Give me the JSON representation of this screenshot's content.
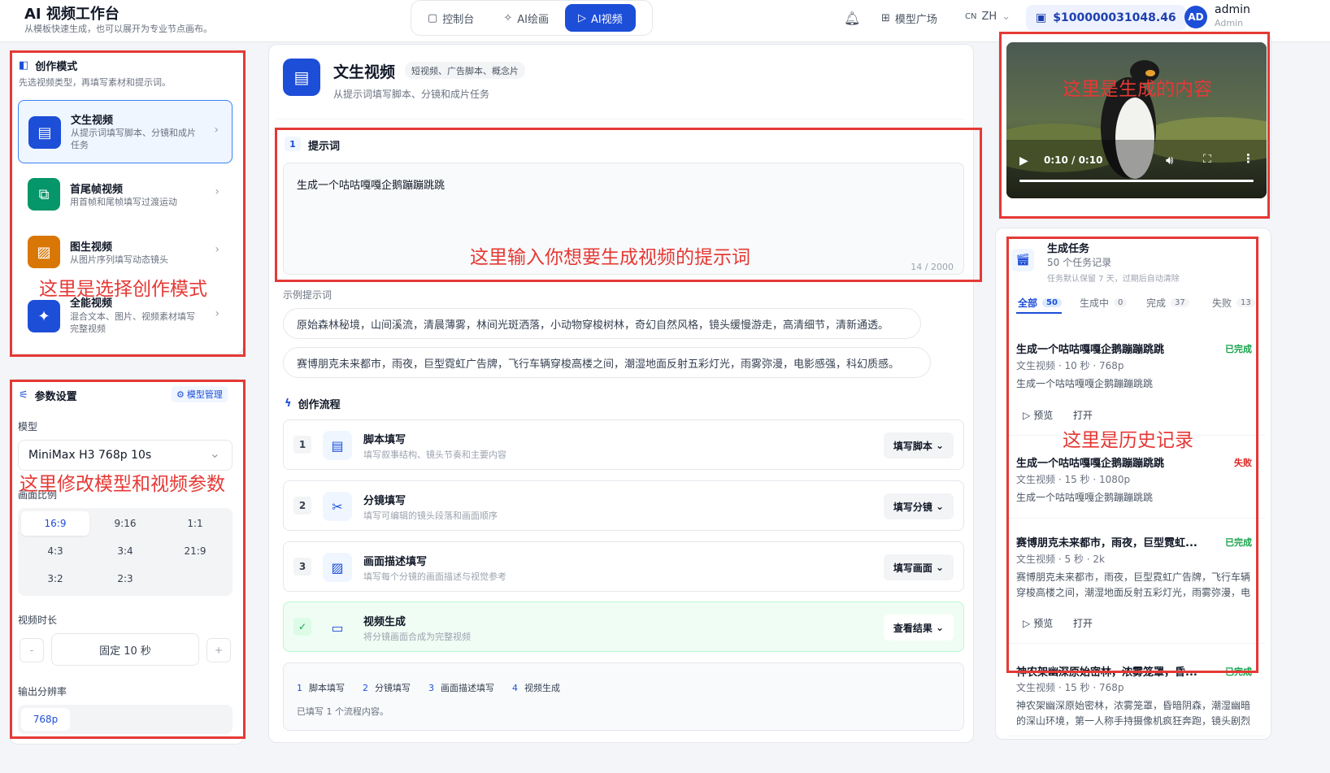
{
  "header": {
    "title": "AI 视频工作台",
    "subtitle": "从模板快速生成，也可以展开为专业节点画布。",
    "tabs": [
      {
        "label": "控制台",
        "icon": "dashboard-icon"
      },
      {
        "label": "AI绘画",
        "icon": "sparkle-icon"
      },
      {
        "label": "AI视频",
        "icon": "play-icon"
      }
    ],
    "model_plaza": "模型广场",
    "lang_prefix": "CN",
    "lang": "ZH",
    "balance": "$100000031048.46",
    "avatar_initials": "AD",
    "user_name": "admin",
    "user_role": "Admin"
  },
  "left": {
    "mode_title": "创作模式",
    "mode_desc": "先选视频类型，再填写素材和提示词。",
    "modes": [
      {
        "title": "文生视频",
        "desc": "从提示词填写脚本、分镜和成片任务",
        "color": "#1d4ed8"
      },
      {
        "title": "首尾帧视频",
        "desc": "用首帧和尾帧填写过渡运动",
        "color": "#059669"
      },
      {
        "title": "图生视频",
        "desc": "从图片序列填写动态镜头",
        "color": "#d97706"
      },
      {
        "title": "全能视频",
        "desc": "混合文本、图片、视频素材填写完整视频",
        "color": "#1d4ed8"
      }
    ],
    "params_title": "参数设置",
    "model_manage": "模型管理",
    "model_label": "模型",
    "model_value": "MiniMax H3 768p 10s",
    "ratio_label": "画面比例",
    "ratios": [
      "16:9",
      "9:16",
      "1:1",
      "4:3",
      "3:4",
      "21:9",
      "3:2",
      "2:3"
    ],
    "duration_label": "视频时长",
    "duration_minus": "-",
    "duration_value": "固定 10 秒",
    "duration_plus": "+",
    "resolution_label": "输出分辨率",
    "resolution_value": "768p"
  },
  "center": {
    "title": "文生视频",
    "tag": "短视频、广告脚本、概念片",
    "subtitle": "从提示词填写脚本、分镜和成片任务",
    "prompt_step": "1",
    "prompt_label": "提示词",
    "prompt_value": "生成一个咕咕嘎嘎企鹅蹦蹦跳跳",
    "prompt_count": "14 / 2000",
    "examples_label": "示例提示词",
    "examples": [
      "原始森林秘境，山间溪流，清晨薄雾，林间光斑洒落，小动物穿梭树林，奇幻自然风格，镜头缓慢游走，高清细节，清新通透。",
      "赛博朋克未来都市，雨夜，巨型霓虹广告牌，飞行车辆穿梭高楼之间，潮湿地面反射五彩灯光，雨雾弥漫，电影感强，科幻质感。"
    ],
    "flow_title": "创作流程",
    "flows": [
      {
        "num": "1",
        "title": "脚本填写",
        "desc": "填写叙事结构、镜头节奏和主要内容",
        "btn": "填写脚本"
      },
      {
        "num": "2",
        "title": "分镜填写",
        "desc": "填写可编辑的镜头段落和画面顺序",
        "btn": "填写分镜"
      },
      {
        "num": "3",
        "title": "画面描述填写",
        "desc": "填写每个分镜的画面描述与视觉参考",
        "btn": "填写画面"
      },
      {
        "num": "✓",
        "title": "视频生成",
        "desc": "将分镜画面合成为完整视频",
        "btn": "查看结果"
      }
    ],
    "summary_steps": [
      {
        "n": "1",
        "label": "脚本填写"
      },
      {
        "n": "2",
        "label": "分镜填写"
      },
      {
        "n": "3",
        "label": "画面描述填写"
      },
      {
        "n": "4",
        "label": "视频生成"
      }
    ],
    "summary_note": "已填写 1 个流程内容。"
  },
  "right": {
    "video_time": "0:10 / 0:10",
    "video_progress": 1.0,
    "tasks_title": "生成任务",
    "tasks_count": "50 个任务记录",
    "tasks_note": "任务默认保留 7 天，过期后自动清除",
    "tabs": [
      {
        "label": "全部",
        "count": "50"
      },
      {
        "label": "生成中",
        "count": "0"
      },
      {
        "label": "完成",
        "count": "37"
      },
      {
        "label": "失败",
        "count": "13"
      }
    ],
    "tasks": [
      {
        "title": "生成一个咕咕嘎嘎企鹅蹦蹦跳跳",
        "status": "已完成",
        "status_color": "#16a34a",
        "meta": "文生视频 · 10 秒 · 768p",
        "prompt": "生成一个咕咕嘎嘎企鹅蹦蹦跳跳",
        "preview": "预览",
        "open": "打开"
      },
      {
        "title": "生成一个咕咕嘎嘎企鹅蹦蹦跳跳",
        "status": "失败",
        "status_color": "#dc2626",
        "meta": "文生视频 · 15 秒 · 1080p",
        "prompt": "生成一个咕咕嘎嘎企鹅蹦蹦跳跳"
      },
      {
        "title": "赛博朋克未来都市，雨夜，巨型霓虹...",
        "status": "已完成",
        "status_color": "#16a34a",
        "meta": "文生视频 · 5 秒 · 2k",
        "prompt": "赛博朋克未来都市，雨夜，巨型霓虹广告牌，飞行车辆穿梭高楼之间，潮湿地面反射五彩灯光，雨雾弥漫，电影...",
        "preview": "预览",
        "open": "打开"
      },
      {
        "title": "神农架幽深原始密林，浓雾笼罩，昏...",
        "status": "已完成",
        "status_color": "#16a34a",
        "meta": "文生视频 · 15 秒 · 768p",
        "prompt": "神农架幽深原始密林，浓雾笼罩，昏暗阴森，潮湿幽暗的深山环境，第一人称手持摄像机疯狂奔跑，镜头剧烈晃..."
      }
    ]
  },
  "annotations": {
    "mode": "这里是选择创作模式",
    "params": "这里修改模型和视频参数",
    "prompt": "这里输入你想要生成视频的提示词",
    "video": "这里是生成的内容",
    "history": "这里是历史记录"
  },
  "colors": {
    "accent": "#1d4ed8",
    "annotation_red": "#e53935",
    "success": "#16a34a",
    "fail": "#dc2626"
  }
}
